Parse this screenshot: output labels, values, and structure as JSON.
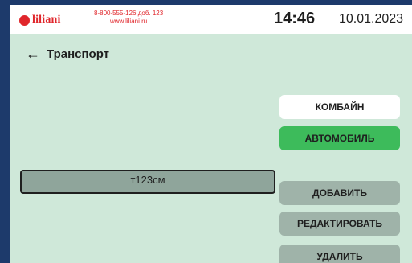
{
  "header": {
    "logo_text": "liliani",
    "phone": "8-800-555-126 доб. 123",
    "website": "www.liliani.ru",
    "time": "14:46",
    "date": "10.01.2023"
  },
  "nav": {
    "back_arrow": "←",
    "title": "Транспорт"
  },
  "categories": [
    {
      "label": "КОМБАЙН",
      "state": "default"
    },
    {
      "label": "АВТОМОБИЛЬ",
      "state": "selected"
    }
  ],
  "vehicle_list": [
    {
      "name": "т123см",
      "selected": true
    }
  ],
  "actions": {
    "add_label": "ДОБАВИТЬ",
    "edit_label": "РЕДАКТИРОВАТЬ",
    "delete_label": "УДАЛИТЬ"
  },
  "colors": {
    "screen_bg": "#cfe8d9",
    "accent_green": "#3dbb5b",
    "brand_red": "#e0262b",
    "inactive_button": "#9fb3a9"
  }
}
